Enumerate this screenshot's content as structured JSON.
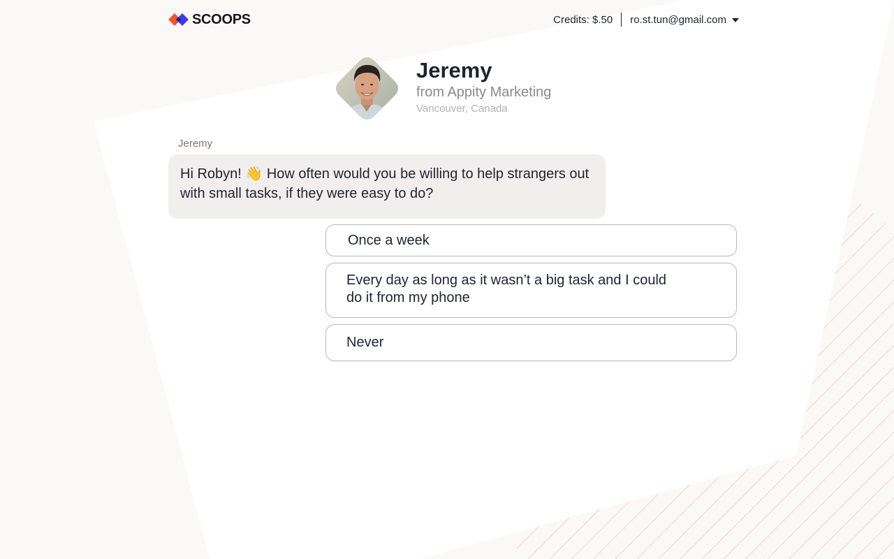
{
  "header": {
    "logo_text": "SCOOPS",
    "credits": "Credits: $.50",
    "account_email": "ro.st.tun@gmail.com"
  },
  "profile": {
    "name": "Jeremy",
    "company": "from Appity Marketing",
    "location": "Vancouver, Canada"
  },
  "chat": {
    "sender": "Jeremy",
    "message_greeting": "Hi Robyn!",
    "message_emoji": "👋",
    "message_body": "How often would you be willing to help strangers out with small tasks, if they were easy to do?"
  },
  "options": [
    {
      "label": "Once a week"
    },
    {
      "label": "Every day as long as it wasn’t a big task and I could do it from my phone"
    },
    {
      "label": "Never"
    }
  ],
  "colors": {
    "background": "#fbf8f8",
    "card": "#ffffff",
    "bubble": "#f1efee",
    "option_border": "#b9b9bd",
    "stripe": "#f7c9b8",
    "logo_orange": "#f2552c",
    "logo_blue": "#3b3ce0"
  },
  "icons": {
    "logo": "scoops-logo-icon",
    "dropdown": "caret-down-icon",
    "emoji": "waving-hand-emoji"
  }
}
